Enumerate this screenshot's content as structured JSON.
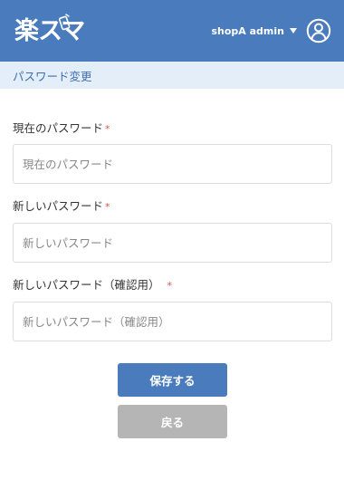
{
  "header": {
    "logo_text": "楽スマ",
    "user_name": "shopA admin",
    "bg_color": "#4a7bbd"
  },
  "page_title": "パスワード変更",
  "form": {
    "required_mark": "*",
    "fields": [
      {
        "label": "現在のパスワード",
        "placeholder": "現在のパスワード",
        "value": ""
      },
      {
        "label": "新しいパスワード",
        "placeholder": "新しいパスワード",
        "value": ""
      },
      {
        "label": "新しいパスワード（確認用）",
        "placeholder": "新しいパスワード（確認用）",
        "value": ""
      }
    ]
  },
  "buttons": {
    "save_label": "保存する",
    "back_label": "戻る"
  },
  "icons": {
    "user": "user-circle-icon",
    "caret": "caret-down-icon",
    "logo_phone": "smartphone-icon"
  },
  "colors": {
    "primary": "#4a7bbd",
    "title_bar_bg": "#e3eef8",
    "required": "#d9534f",
    "disabled_button": "#b5b5b5"
  }
}
